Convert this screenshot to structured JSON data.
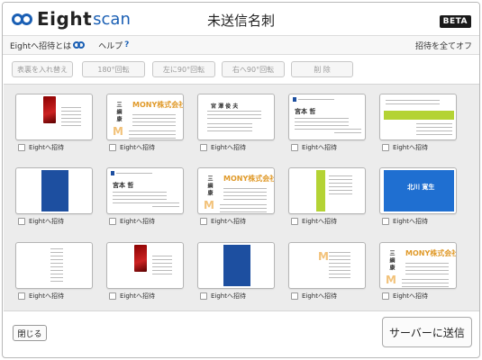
{
  "app": {
    "logo_brand": "Eight",
    "logo_suffix": "scan",
    "title": "未送信名刺",
    "badge": "BETA"
  },
  "nav": {
    "invite_label": "Eightへ招待とは",
    "help_label": "ヘルプ",
    "help_mark": "?",
    "optout_label": "招待を全てオフ"
  },
  "toolbar": {
    "swap_label": "表裏を入れ替え",
    "rotate180_label": "180°回転",
    "rotate_left_label": "左に90°回転",
    "rotate_right_label": "右へ90°回転",
    "delete_label": "削 除"
  },
  "cards": [
    {
      "style": "red",
      "invite_label": "Eightへ招待",
      "checked": false
    },
    {
      "style": "mony",
      "brand": "MONY株式会社",
      "invite_label": "Eightへ招待",
      "checked": false
    },
    {
      "style": "jp-white",
      "name": "宮 澤 俊 夫",
      "invite_label": "Eightへ招待",
      "checked": false
    },
    {
      "style": "bluetop",
      "name": "宮本 哲",
      "invite_label": "Eightへ招待",
      "checked": false
    },
    {
      "style": "green",
      "invite_label": "Eightへ招待",
      "checked": false
    },
    {
      "style": "bluecard-v",
      "invite_label": "Eightへ招待",
      "checked": false
    },
    {
      "style": "bluetop",
      "name": "宮本 哲",
      "invite_label": "Eightへ招待",
      "checked": false
    },
    {
      "style": "mony",
      "brand": "MONY株式会社",
      "invite_label": "Eightへ招待",
      "checked": false
    },
    {
      "style": "greenside",
      "invite_label": "Eightへ招待",
      "checked": false
    },
    {
      "style": "bluecard-h",
      "name": "北川 寛生",
      "invite_label": "Eightへ招待",
      "checked": false
    },
    {
      "style": "vertical",
      "invite_label": "Eightへ招待",
      "checked": false
    },
    {
      "style": "red",
      "invite_label": "Eightへ招待",
      "checked": false
    },
    {
      "style": "bluecard-v",
      "invite_label": "Eightへ招待",
      "checked": false
    },
    {
      "style": "orangeside",
      "invite_label": "Eightへ招待",
      "checked": false
    },
    {
      "style": "mony",
      "brand": "MONY株式会社",
      "invite_label": "Eightへ招待",
      "checked": false
    }
  ],
  "footer": {
    "close_label": "閉じる",
    "send_label": "サーバーに送信"
  },
  "colors": {
    "accent": "#1a5fb4",
    "brand_orange": "#e09a2a",
    "panel_bg": "#ececec"
  },
  "icons": [
    "eight-logo-icon",
    "eight-mini-logo-icon",
    "help-icon",
    "checkbox-icon"
  ]
}
